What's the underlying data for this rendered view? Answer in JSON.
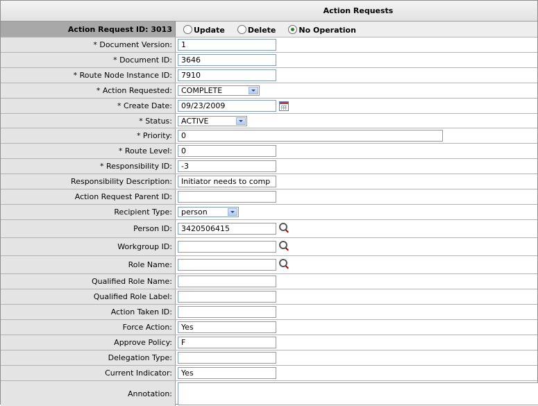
{
  "title": "Action Requests",
  "action_request": {
    "label": "Action Request ID: 3013",
    "options": [
      {
        "label": "Update",
        "checked": false
      },
      {
        "label": "Delete",
        "checked": false
      },
      {
        "label": "No Operation",
        "checked": true
      }
    ]
  },
  "fields": {
    "document_version": {
      "label": "* Document Version:",
      "value": "1"
    },
    "document_id": {
      "label": "* Document ID:",
      "value": "3646"
    },
    "route_node_instance_id": {
      "label": "* Route Node Instance ID:",
      "value": "7910"
    },
    "action_requested": {
      "label": "* Action Requested:",
      "value": "COMPLETE"
    },
    "create_date": {
      "label": "* Create Date:",
      "value": "09/23/2009"
    },
    "status": {
      "label": "* Status:",
      "value": "ACTIVE"
    },
    "priority": {
      "label": "* Priority:",
      "value": "0"
    },
    "route_level": {
      "label": "* Route Level:",
      "value": "0"
    },
    "responsibility_id": {
      "label": "* Responsibility ID:",
      "value": "-3"
    },
    "responsibility_description": {
      "label": "Responsibility Description:",
      "value": "Initiator needs to comp"
    },
    "action_request_parent_id": {
      "label": "Action Request Parent ID:",
      "value": ""
    },
    "recipient_type": {
      "label": "Recipient Type:",
      "value": "person"
    },
    "person_id": {
      "label": "Person ID:",
      "value": "3420506415"
    },
    "workgroup_id": {
      "label": "Workgroup ID:",
      "value": ""
    },
    "role_name": {
      "label": "Role Name:",
      "value": ""
    },
    "qualified_role_name": {
      "label": "Qualified Role Name:",
      "value": ""
    },
    "qualified_role_label": {
      "label": "Qualified Role Label:",
      "value": ""
    },
    "action_taken_id": {
      "label": "Action Taken ID:",
      "value": ""
    },
    "force_action": {
      "label": "Force Action:",
      "value": "Yes"
    },
    "approve_policy": {
      "label": "Approve Policy:",
      "value": "F"
    },
    "delegation_type": {
      "label": "Delegation Type:",
      "value": ""
    },
    "current_indicator": {
      "label": "Current Indicator:",
      "value": "Yes"
    },
    "annotation": {
      "label": "Annotation:",
      "value": ""
    }
  },
  "icons": {
    "calendar": "calendar-icon",
    "lookup": "lookup-icon",
    "dropdown": "chevron-down-icon"
  },
  "colors": {
    "label_bg": "#e4e4e4",
    "header_row_bg": "#a8a8a8",
    "radio_checked": "#2e7d32"
  }
}
